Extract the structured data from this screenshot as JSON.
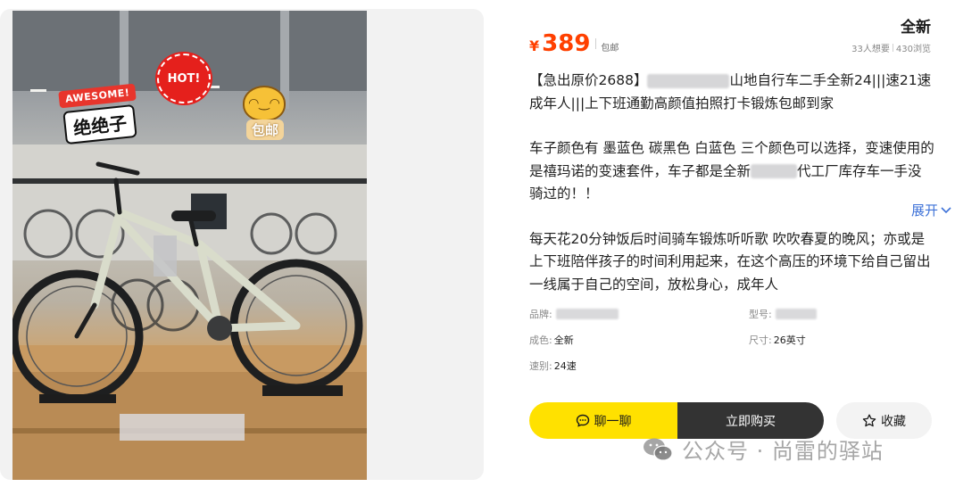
{
  "listing": {
    "condition": "全新",
    "currency": "¥",
    "price": "389",
    "shipping": "包邮",
    "wants": "33人想要",
    "views": "430浏览",
    "title_part1": "【急出原价2688】",
    "title_part2": "山地自行车二手全新24|||速21速成年人|||上下班通勤高颜值拍照打卡锻炼包邮到家",
    "desc_para2_a": "车子颜色有 墨蓝色 碳黑色 白蓝色 三个颜色可以选择，变速使用的是禧玛诺的变速套件，车子都是全新",
    "desc_para2_b": "代工厂库存车一手没骑过的！！",
    "desc_para3": "每天花20分钟饭后时间骑车锻炼听听歌 吹吹春夏的晚风；亦或是上下班陪伴孩子的时间利用起来，在这个高压的环境下给自己留出一线属于自己的空间，放松身心，成年人",
    "expand_label": "展开"
  },
  "attributes": {
    "brand_label": "品牌:",
    "model_label": "型号:",
    "condition_label": "成色:",
    "condition_value": "全新",
    "size_label": "尺寸:",
    "size_value": "26英寸",
    "speed_label": "速别:",
    "speed_value": "24速"
  },
  "actions": {
    "chat_label": "聊一聊",
    "buy_label": "立即购买",
    "favorite_label": "收藏"
  },
  "photo": {
    "sticker_awesome_top": "AWESOME!",
    "sticker_awesome_main": "绝绝子",
    "sticker_hot": "HOT!",
    "sticker_baoyou": "包邮"
  },
  "watermark": {
    "text": "公众号 · 尚雷的驿站"
  },
  "colors": {
    "price": "#ff4000",
    "accent_yellow": "#ffe100",
    "buy_button": "#333333",
    "link": "#3e72d8"
  },
  "icons": {
    "chat": "chat-bubble-icon",
    "favorite": "star-outline-icon",
    "expand": "chevron-down-icon",
    "watermark": "wechat-icon"
  }
}
